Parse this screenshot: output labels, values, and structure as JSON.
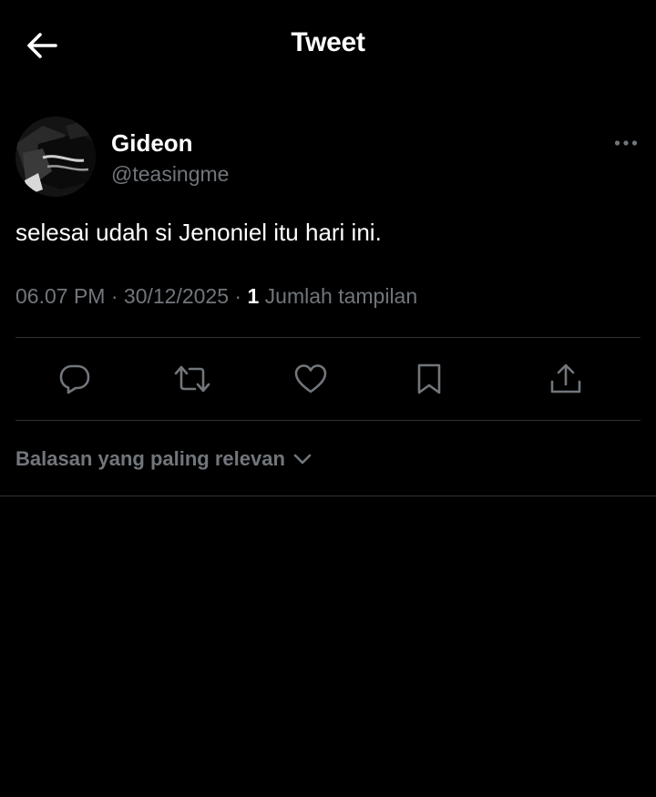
{
  "header": {
    "title": "Tweet",
    "back_icon": "arrow-left-icon"
  },
  "tweet": {
    "author": {
      "name": "Gideon",
      "handle": "@teasingme",
      "avatar": "profile-photo"
    },
    "more_icon": "more-horizontal-icon",
    "text": "selesai udah si Jenoniel itu hari ini.",
    "time": "06.07 PM",
    "separator": "·",
    "date": "30/12/2025",
    "views_count": "1",
    "views_label": "Jumlah tampilan"
  },
  "actions": [
    {
      "name": "reply",
      "icon": "reply-icon"
    },
    {
      "name": "retweet",
      "icon": "retweet-icon"
    },
    {
      "name": "like",
      "icon": "heart-icon"
    },
    {
      "name": "bookmark",
      "icon": "bookmark-icon"
    },
    {
      "name": "share",
      "icon": "share-icon"
    }
  ],
  "replies": {
    "sort_label": "Balasan yang paling relevan",
    "sort_icon": "chevron-down-icon"
  },
  "colors": {
    "background": "#000000",
    "primary_text": "#ffffff",
    "secondary_text": "#71767b",
    "divider": "#2f3336"
  }
}
